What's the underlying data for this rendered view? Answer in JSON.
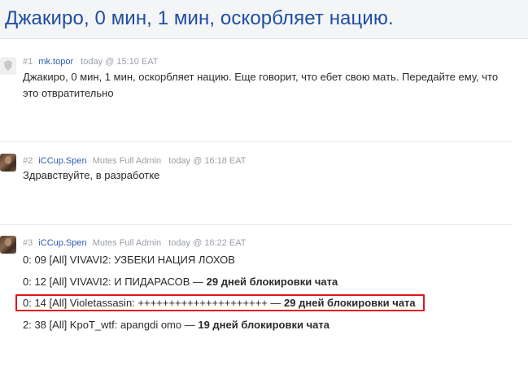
{
  "thread": {
    "title": "Джакиро, 0 мин, 1 мин, оскорбляет нацию."
  },
  "posts": [
    {
      "number": "#1",
      "author": "mk.topor",
      "role": "",
      "time": "today @ 15:10 EAT",
      "body": "Джакиро, 0 мин, 1 мин, оскорбляет нацию. Еще говорит, что ебет свою мать. Передайте ему, что это отвратительно"
    },
    {
      "number": "#2",
      "author": "iCCup.Spen",
      "role": "Mutes Full Admin",
      "time": "today @ 16:18 EAT",
      "body": "Здравствуйте, в разработке"
    },
    {
      "number": "#3",
      "author": "iCCup.Spen",
      "role": "Mutes Full Admin",
      "time": "today @ 16:22 EAT",
      "lines": [
        {
          "text": "0: 09 [All] VIVAVI2: УЗБЕКИ НАЦИЯ ЛОХОВ",
          "bold": ""
        },
        {
          "text": "0: 12 [All] VIVAVI2: И ПИДАРАСОВ — ",
          "bold": "29 дней блокировки чата"
        },
        {
          "text": "0: 14 [All] Violetassasin: +++++++++++++++++++++ — ",
          "bold": "29 дней блокировки чата"
        },
        {
          "text": "2: 38 [All] KpoT_wtf: apangdi omo — ",
          "bold": "19 дней блокировки чата"
        }
      ]
    }
  ],
  "colors": {
    "title": "#1f4ea1",
    "author": "#2a5db0",
    "highlight_border": "#e0141e"
  }
}
